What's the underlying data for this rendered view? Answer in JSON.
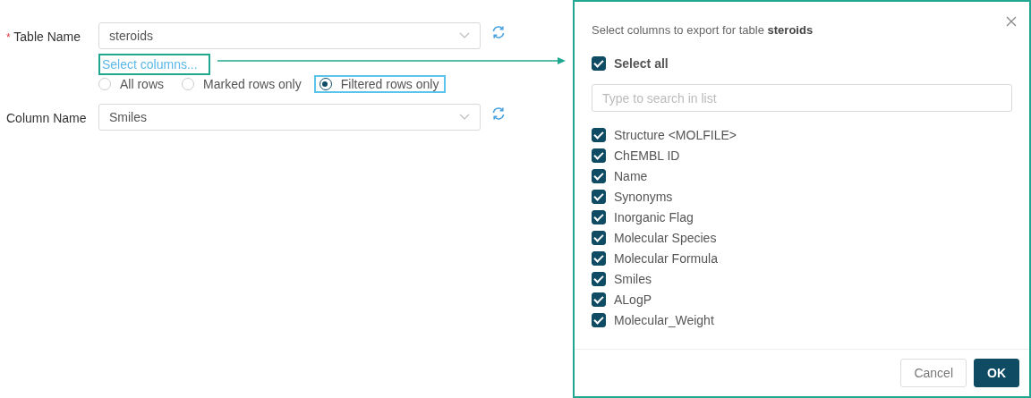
{
  "form": {
    "table_field": {
      "required_mark": "*",
      "label": "Table Name",
      "value": "steroids"
    },
    "select_columns_link": "Select columns...",
    "row_options": [
      {
        "label": "All rows",
        "selected": false
      },
      {
        "label": "Marked rows only",
        "selected": false
      },
      {
        "label": "Filtered rows only",
        "selected": true
      }
    ],
    "column_field": {
      "label": "Column Name",
      "value": "Smiles"
    }
  },
  "dialog": {
    "title": "Select columns to export for table **steroids**",
    "select_all": {
      "label": "Select all",
      "checked": true
    },
    "search": {
      "placeholder": "Type to search in list"
    },
    "columns": [
      {
        "label": "Structure <MOLFILE>",
        "checked": true
      },
      {
        "label": "ChEMBL ID",
        "checked": true
      },
      {
        "label": "Name",
        "checked": true
      },
      {
        "label": "Synonyms",
        "checked": true
      },
      {
        "label": "Inorganic Flag",
        "checked": true
      },
      {
        "label": "Molecular Species",
        "checked": true
      },
      {
        "label": "Molecular Formula",
        "checked": true
      },
      {
        "label": "Smiles",
        "checked": true
      },
      {
        "label": "ALogP",
        "checked": true
      },
      {
        "label": "Molecular_Weight",
        "checked": true
      }
    ],
    "buttons": [
      {
        "label": "Cancel",
        "kind": "secondary"
      },
      {
        "label": "OK",
        "kind": "primary"
      }
    ]
  }
}
